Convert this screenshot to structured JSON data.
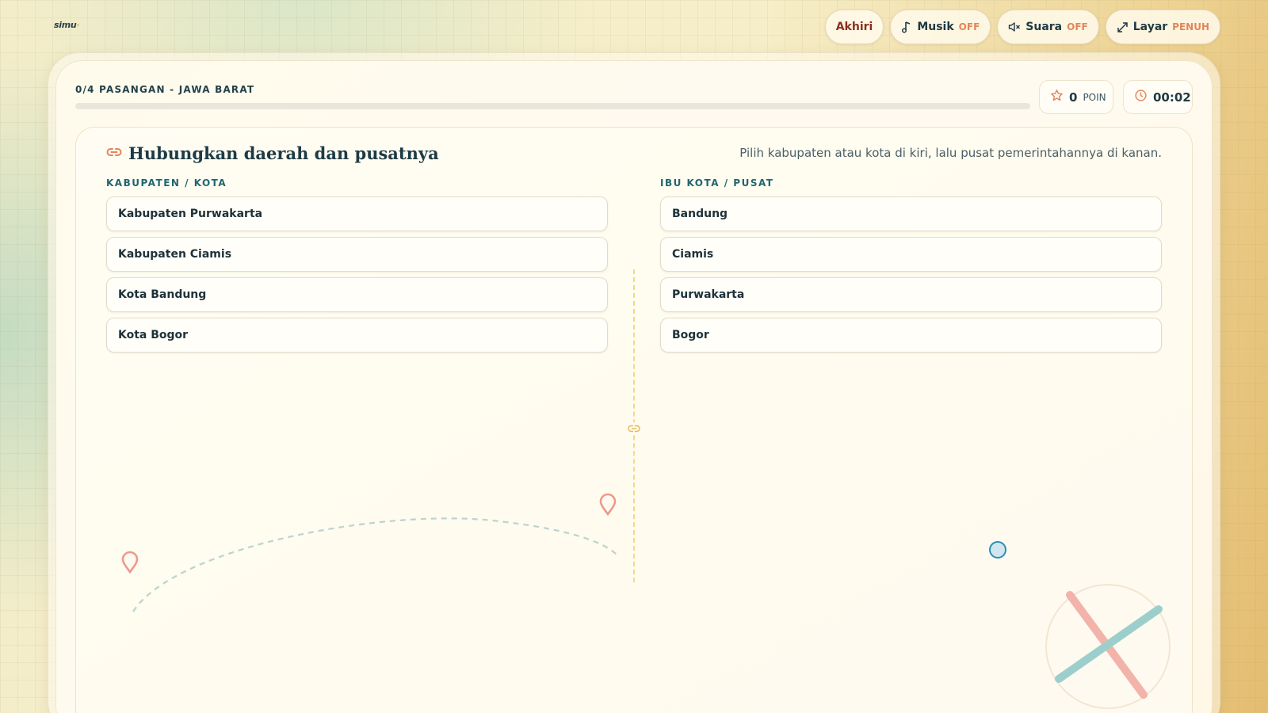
{
  "app": {
    "logo": "simu"
  },
  "controls": {
    "end_label": "Akhiri",
    "music_label": "Musik",
    "music_state": "OFF",
    "sound_label": "Suara",
    "sound_state": "OFF",
    "screen_label": "Layar",
    "screen_state": "PENUH"
  },
  "progress": {
    "label": "0/4 PASANGAN - JAWA BARAT",
    "matched": 0,
    "total": 4,
    "fraction": 0
  },
  "stats": {
    "points_value": "0",
    "points_unit": "POIN",
    "timer": "00:02"
  },
  "game": {
    "title": "Hubungkan daerah dan pusatnya",
    "instruction": "Pilih kabupaten atau kota di kiri, lalu pusat pemerintahannya di kanan.",
    "left_header": "KABUPATEN / KOTA",
    "right_header": "IBU KOTA / PUSAT",
    "left_items": [
      "Kabupaten Purwakarta",
      "Kabupaten Ciamis",
      "Kota Bandung",
      "Kota Bogor"
    ],
    "right_items": [
      "Bandung",
      "Ciamis",
      "Purwakarta",
      "Bogor"
    ]
  },
  "icons": {
    "music": "music-note-icon",
    "sound": "speaker-muted-icon",
    "screen": "expand-icon",
    "points": "star-icon",
    "timer": "clock-icon",
    "title": "link-icon"
  },
  "colors": {
    "accent_orange": "#e2855a",
    "end_button_text": "#8c2d1f",
    "header_teal": "#1f6670",
    "pin_coral": "#ec9a8c",
    "cross_teal": "#9ccfcc",
    "cross_pink": "#f2b3ab"
  }
}
